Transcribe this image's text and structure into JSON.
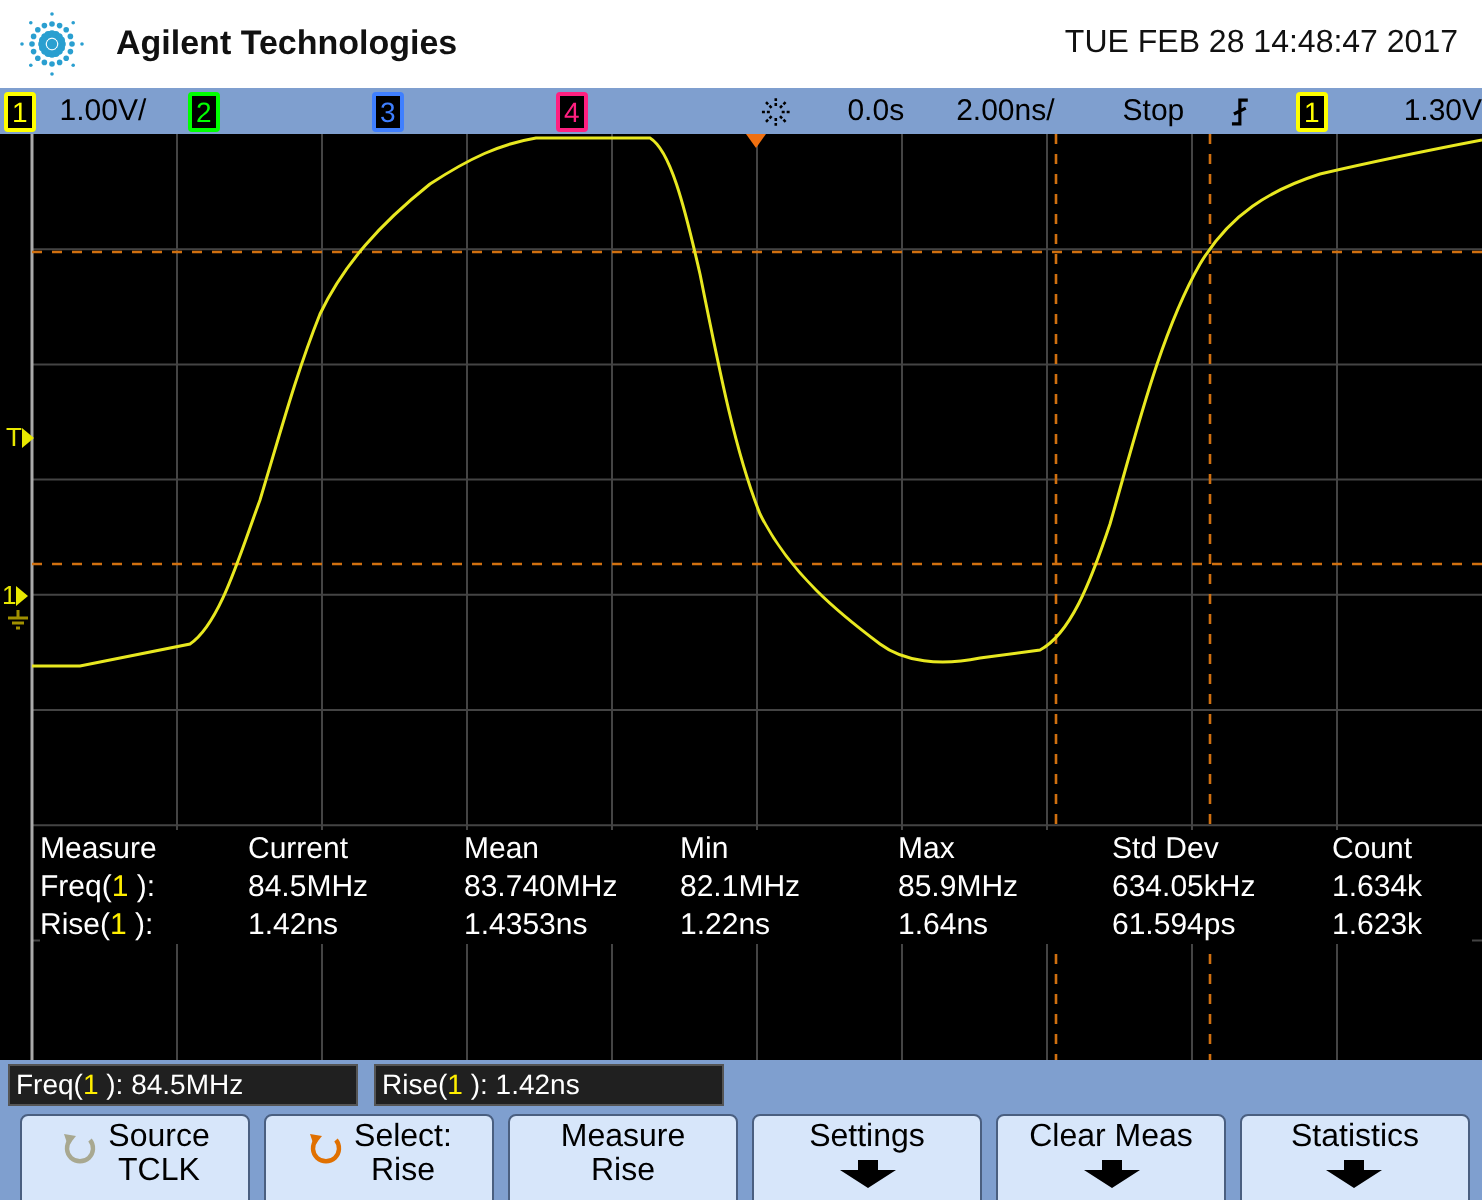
{
  "header": {
    "brand": "Agilent Technologies",
    "datetime": "TUE FEB 28 14:48:47 2017"
  },
  "status_bar": {
    "channels": [
      {
        "label": "1",
        "color": "#ffff00",
        "scale": "1.00V/"
      },
      {
        "label": "2",
        "color": "#00ff00"
      },
      {
        "label": "3",
        "color": "#3f7fff"
      },
      {
        "label": "4",
        "color": "#ff2080"
      }
    ],
    "delay": "0.0s",
    "timebase": "2.00ns/",
    "run_state": "Stop",
    "trigger_source": {
      "label": "1",
      "color": "#ffff00"
    },
    "trigger_level": "1.30V"
  },
  "display": {
    "trigger_marker": "T",
    "channel_marker": "1",
    "measurements": {
      "columns": [
        "Measure",
        "Current",
        "Mean",
        "Min",
        "Max",
        "Std Dev",
        "Count"
      ],
      "rows": [
        {
          "name": "Freq(",
          "source": "1",
          "suffix": " ):",
          "values": [
            "84.5MHz",
            "83.740MHz",
            "82.1MHz",
            "85.9MHz",
            "634.05kHz",
            "1.634k"
          ]
        },
        {
          "name": "Rise(",
          "source": "1",
          "suffix": " ):",
          "values": [
            "1.42ns",
            "1.4353ns",
            "1.22ns",
            "1.64ns",
            "61.594ps",
            "1.623k"
          ]
        }
      ]
    }
  },
  "readouts": [
    {
      "name": "Freq(",
      "source": "1",
      "suffix": " ): 84.5MHz"
    },
    {
      "name": "Rise(",
      "source": "1",
      "suffix": " ): 1.42ns"
    }
  ],
  "softkeys": [
    {
      "kind": "rotary",
      "active": false,
      "lines": [
        "Source",
        "TCLK"
      ]
    },
    {
      "kind": "rotary",
      "active": true,
      "lines": [
        "Select:",
        "Rise"
      ]
    },
    {
      "kind": "plain",
      "lines": [
        "Measure",
        "Rise"
      ]
    },
    {
      "kind": "menu",
      "lines": [
        "Settings"
      ]
    },
    {
      "kind": "menu",
      "lines": [
        "Clear Meas"
      ]
    },
    {
      "kind": "menu",
      "lines": [
        "Statistics"
      ]
    }
  ]
}
